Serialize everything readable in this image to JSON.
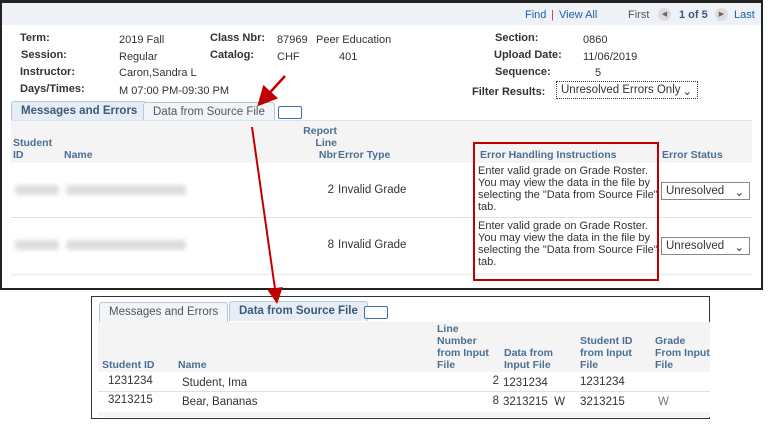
{
  "nav": {
    "find": "Find",
    "sep": "|",
    "view_all": "View All",
    "first": "First",
    "position": "1 of 5",
    "last": "Last"
  },
  "info": {
    "term_label": "Term:",
    "term": "2019 Fall",
    "session_label": "Session:",
    "session": "Regular",
    "instructor_label": "Instructor:",
    "instructor": "Caron,Sandra L",
    "days_label": "Days/Times:",
    "days": "M 07:00 PM-09:30 PM",
    "class_nbr_label": "Class Nbr:",
    "class_nbr": "87969",
    "class_name": "Peer Education",
    "catalog_label": "Catalog:",
    "catalog_subject": "CHF",
    "catalog_nbr": "401",
    "section_label": "Section:",
    "section": "0860",
    "upload_label": "Upload Date:",
    "upload": "11/06/2019",
    "sequence_label": "Sequence:",
    "sequence": "5",
    "filter_label": "Filter Results:",
    "filter_value": "Unresolved Errors Only"
  },
  "tabs": [
    "Messages and Errors",
    "Data from Source File"
  ],
  "errors": {
    "headers": {
      "student_id": "Student ID",
      "name": "Name",
      "line": "Report Line Nbr",
      "type": "Error Type",
      "instr": "Error Handling Instructions",
      "status": "Error Status"
    },
    "rows": [
      {
        "line": "2",
        "type": "Invalid Grade",
        "instr": "Enter valid grade on Grade Roster. You may view the data in the file by selecting the \"Data from Source File\" tab.",
        "status": "Unresolved"
      },
      {
        "line": "8",
        "type": "Invalid Grade",
        "instr": "Enter valid grade on Grade Roster. You may view the data in the file by selecting the \"Data from Source File\" tab.",
        "status": "Unresolved"
      }
    ]
  },
  "source": {
    "headers": {
      "student_id": "Student ID",
      "name": "Name",
      "line": "Line Number from Input File",
      "data": "Data from Input File",
      "sid": "Student ID from Input File",
      "grade": "Grade From Input File"
    },
    "rows": [
      {
        "student_id": "1231234",
        "name": "Student, Ima",
        "line": "2",
        "data": "1231234",
        "sid": "1231234",
        "grade": ""
      },
      {
        "student_id": "3213215",
        "name": "Bear, Bananas",
        "line": "8",
        "data": "3213215  W",
        "sid": "3213215",
        "grade": "W"
      }
    ]
  },
  "colors": {
    "highlight": "#c00000",
    "header_text": "#4a6f93",
    "link": "#1f5fa7"
  }
}
